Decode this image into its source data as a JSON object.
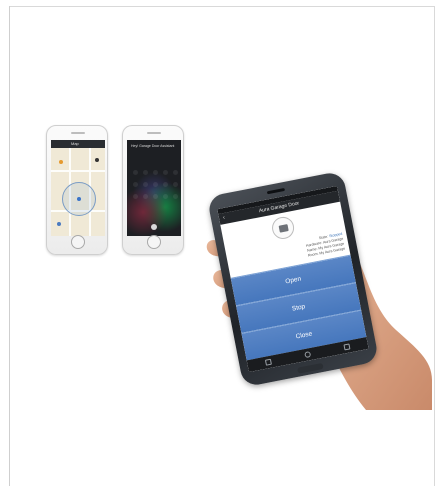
{
  "photo": {
    "left_phone": {
      "top_bar_title": "Map"
    },
    "middle_phone": {
      "assistant_text": "Hey! Garage Door Assistant"
    },
    "right_phone": {
      "title": "Aura Garage Door",
      "info": [
        {
          "label": "State:",
          "value": "Stopped"
        },
        {
          "label": "Hardware:",
          "value": "Aura Garage"
        },
        {
          "label": "Name:",
          "value": "My Aura Garage"
        },
        {
          "label": "Room:",
          "value": "My Aura Garage"
        }
      ],
      "buttons": [
        "Open",
        "Stop",
        "Close"
      ]
    }
  }
}
